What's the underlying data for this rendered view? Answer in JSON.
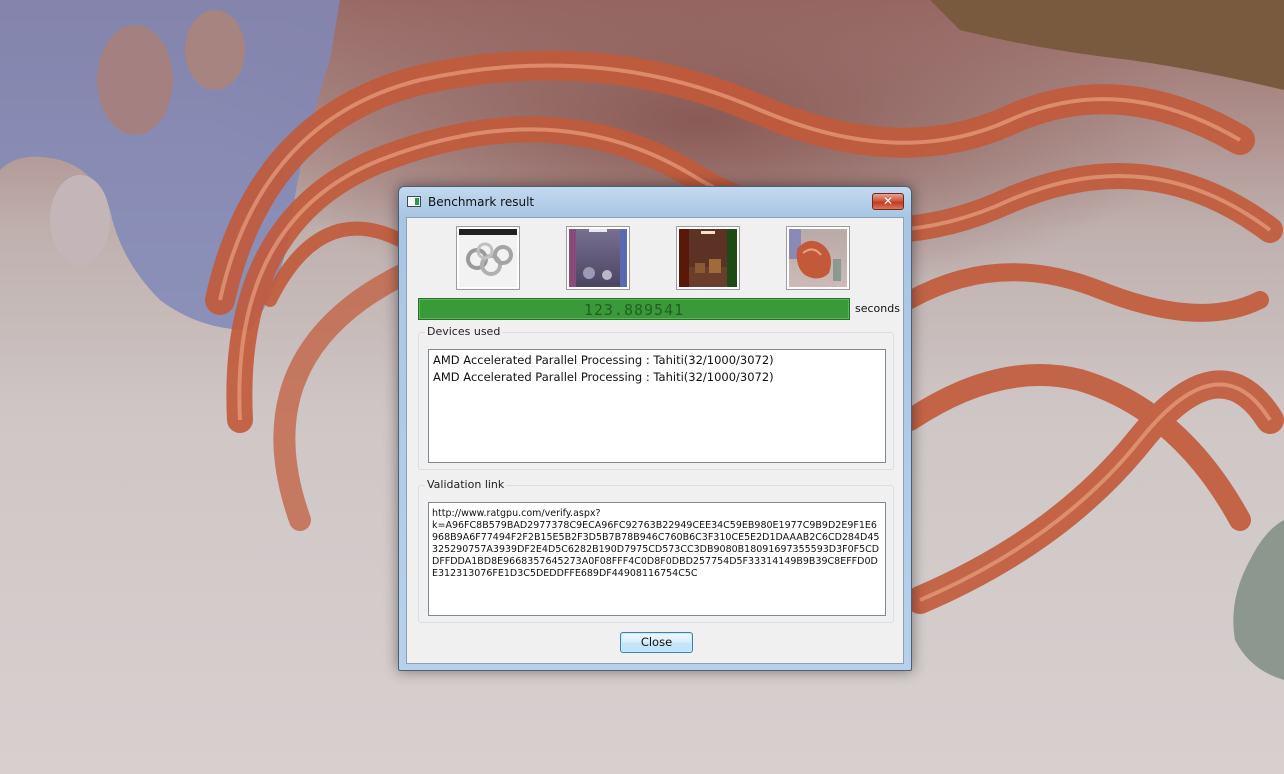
{
  "window": {
    "title": "Benchmark result",
    "close_glyph": "✕"
  },
  "thumbnails": [
    {
      "icon": "knots-scene-thumbnail"
    },
    {
      "icon": "spheres-room-thumbnail"
    },
    {
      "icon": "cornell-box-thumbnail"
    },
    {
      "icon": "glass-sculpture-thumbnail"
    }
  ],
  "result": {
    "time": "123.889541",
    "unit_label": "seconds",
    "bar_color": "#3a9a3a"
  },
  "devices": {
    "label": "Devices used",
    "items": [
      "AMD Accelerated Parallel Processing : Tahiti(32/1000/3072)",
      "AMD Accelerated Parallel Processing : Tahiti(32/1000/3072)"
    ]
  },
  "validation": {
    "label": "Validation link",
    "link": "http://www.ratgpu.com/verify.aspx?\nk=A96FC8B579BAD2977378C9ECA96FC92763B22949CEE34C59EB980E1977C9B9D2E9F1E6968B9A6F77494F2F2B15E5B2F3D5B7B78B946C760B6C3F310CE5E2D1DAAAB2C6CD284D45325290757A3939DF2E4D5C6282B190D7975CD573CC3DB9080B18091697355593D3F0F5CDDFFDDA1BD8E9668357645273A0F08FFF4C0D8F0DBD257754D5F33314149B9B39C8EFFD0DE312313076FE1D3C5DEDDFFE689DF44908116754C5C"
  },
  "buttons": {
    "close_label": "Close"
  }
}
